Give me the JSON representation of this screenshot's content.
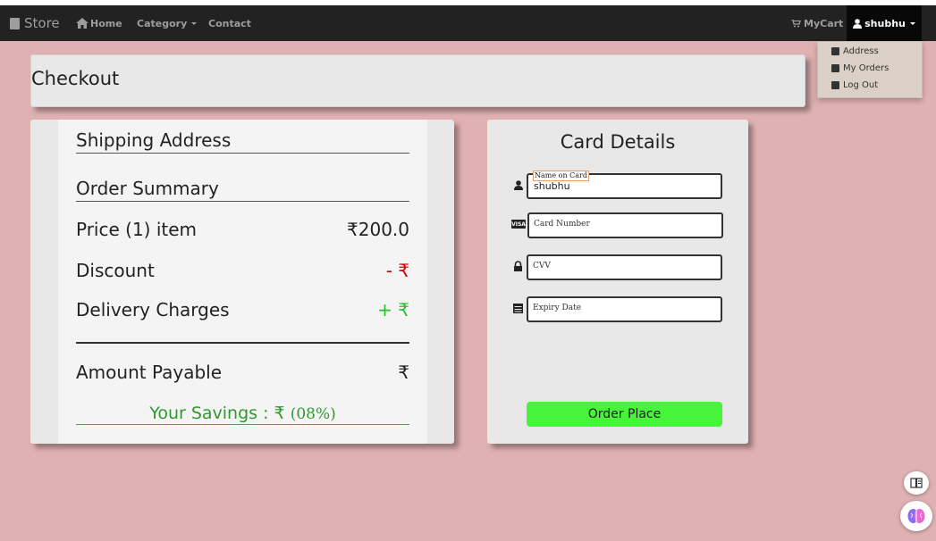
{
  "nav": {
    "brand": "Store",
    "home": "Home",
    "category": "Category",
    "contact": "Contact",
    "mycart": "MyCart",
    "user": "shubhu"
  },
  "dropdown": {
    "items": [
      "Address",
      "My Orders",
      "Log Out"
    ]
  },
  "checkout": {
    "title": "Checkout"
  },
  "summary": {
    "shipping_heading": "Shipping Address",
    "order_heading": "Order Summary",
    "price_label": "Price (1) item",
    "price_value": "₹200.0",
    "discount_label": "Discount",
    "discount_value": "- ₹",
    "delivery_label": "Delivery Charges",
    "delivery_value": "+ ₹",
    "payable_label": "Amount Payable",
    "payable_value": "₹",
    "savings_prefix": "Your Savings : ₹",
    "savings_pct": "(08%)"
  },
  "card": {
    "title": "Card Details",
    "name_label": "Name on Card",
    "name_value": "shubhu",
    "number_placeholder": "Card Number",
    "cvv_placeholder": "CVV",
    "expiry_placeholder": "Expiry Date",
    "order_button": "Order Place"
  },
  "colors": {
    "page_bg": "#e0b1b2",
    "navbar": "#222222",
    "order_button": "#47f33b",
    "discount": "#d40000",
    "delivery": "#28c028",
    "savings": "#2e9a2e"
  },
  "icons": [
    "book-icon",
    "home-icon",
    "cart-icon",
    "user-icon",
    "address-book-icon",
    "shopping-bag-icon",
    "logout-icon",
    "visa-card-icon",
    "lock-icon",
    "calendar-icon",
    "reader-icon",
    "brain-icon"
  ]
}
